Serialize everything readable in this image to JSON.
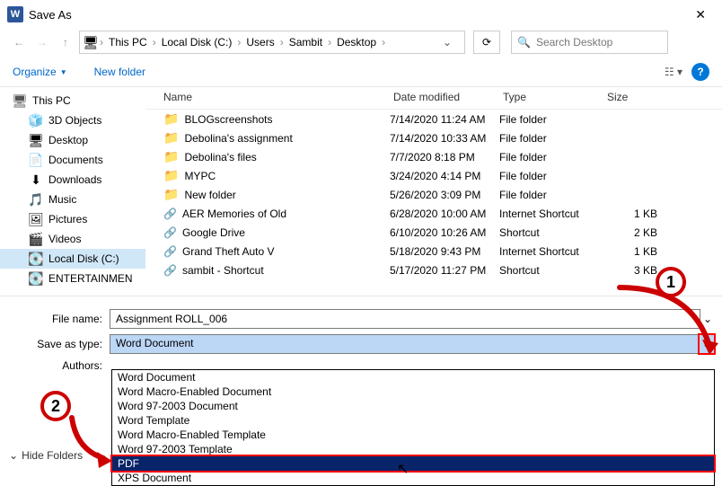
{
  "title": "Save As",
  "breadcrumb": [
    "This PC",
    "Local Disk (C:)",
    "Users",
    "Sambit",
    "Desktop"
  ],
  "search_placeholder": "Search Desktop",
  "toolbar": {
    "organize": "Organize",
    "newfolder": "New folder"
  },
  "sidebar": {
    "items": [
      {
        "label": "This PC"
      },
      {
        "label": "3D Objects"
      },
      {
        "label": "Desktop"
      },
      {
        "label": "Documents"
      },
      {
        "label": "Downloads"
      },
      {
        "label": "Music"
      },
      {
        "label": "Pictures"
      },
      {
        "label": "Videos"
      },
      {
        "label": "Local Disk (C:)"
      },
      {
        "label": "ENTERTAINMEN"
      }
    ]
  },
  "columns": {
    "name": "Name",
    "date": "Date modified",
    "type": "Type",
    "size": "Size"
  },
  "files": [
    {
      "icon": "folder",
      "name": "BLOGscreenshots",
      "date": "7/14/2020 11:24 AM",
      "type": "File folder",
      "size": ""
    },
    {
      "icon": "folder",
      "name": "Debolina's assignment",
      "date": "7/14/2020 10:33 AM",
      "type": "File folder",
      "size": ""
    },
    {
      "icon": "folder",
      "name": "Debolina's files",
      "date": "7/7/2020 8:18 PM",
      "type": "File folder",
      "size": ""
    },
    {
      "icon": "folder",
      "name": "MYPC",
      "date": "3/24/2020 4:14 PM",
      "type": "File folder",
      "size": ""
    },
    {
      "icon": "folder",
      "name": "New folder",
      "date": "5/26/2020 3:09 PM",
      "type": "File folder",
      "size": ""
    },
    {
      "icon": "shortcut",
      "name": "AER Memories of Old",
      "date": "6/28/2020 10:00 AM",
      "type": "Internet Shortcut",
      "size": "1 KB"
    },
    {
      "icon": "shortcut",
      "name": "Google Drive",
      "date": "6/10/2020 10:26 AM",
      "type": "Shortcut",
      "size": "2 KB"
    },
    {
      "icon": "shortcut",
      "name": "Grand Theft Auto V",
      "date": "5/18/2020 9:43 PM",
      "type": "Internet Shortcut",
      "size": "1 KB"
    },
    {
      "icon": "shortcut",
      "name": "sambit - Shortcut",
      "date": "5/17/2020 11:27 PM",
      "type": "Shortcut",
      "size": "3 KB"
    }
  ],
  "form": {
    "filename_label": "File name:",
    "filename_value": "Assignment ROLL_006",
    "saveas_label": "Save as type:",
    "saveas_value": "Word Document",
    "authors_label": "Authors:"
  },
  "dropdown_options": [
    "Word Document",
    "Word Macro-Enabled Document",
    "Word 97-2003 Document",
    "Word Template",
    "Word Macro-Enabled Template",
    "Word 97-2003 Template",
    "PDF",
    "XPS Document"
  ],
  "hidefolders": "Hide Folders",
  "callouts": {
    "one": "1",
    "two": "2"
  }
}
